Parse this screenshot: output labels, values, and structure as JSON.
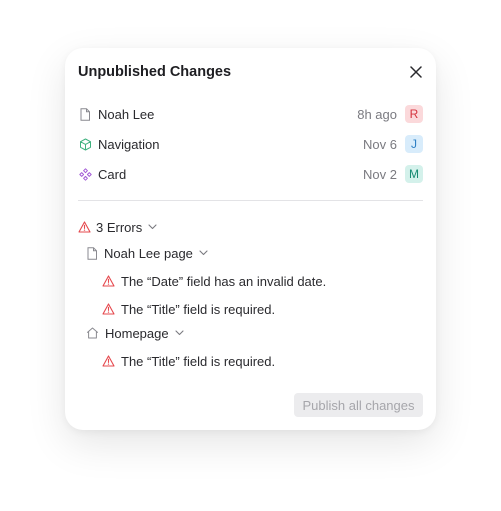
{
  "dialog": {
    "title": "Unpublished Changes",
    "close_icon": "close-icon"
  },
  "changes": [
    {
      "name": "Noah Lee",
      "time": "8h ago",
      "avatar": "R",
      "icon": "document-icon",
      "avatar_bg": "#fbd9db",
      "avatar_fg": "#d5343f"
    },
    {
      "name": "Navigation",
      "time": "Nov 6",
      "avatar": "J",
      "icon": "cube-icon",
      "avatar_bg": "#d8ecfb",
      "avatar_fg": "#2d7fc4"
    },
    {
      "name": "Card",
      "time": "Nov 2",
      "avatar": "M",
      "icon": "component-icon",
      "avatar_bg": "#d4f1eb",
      "avatar_fg": "#178a72"
    }
  ],
  "errors": {
    "label": "3 Errors",
    "pages": [
      {
        "name": "Noah Lee page",
        "icon": "document-icon",
        "messages": [
          "The “Date” field has an invalid date.",
          "The “Title” field is required."
        ]
      },
      {
        "name": "Homepage",
        "icon": "home-icon",
        "messages": [
          "The “Title” field is required."
        ]
      }
    ]
  },
  "footer": {
    "publish_label": "Publish all changes"
  },
  "colors": {
    "error_red": "#e5484d",
    "cube_green": "#3fb27f",
    "component_purple": "#a35cd6",
    "muted_gray": "#8a8a90"
  }
}
